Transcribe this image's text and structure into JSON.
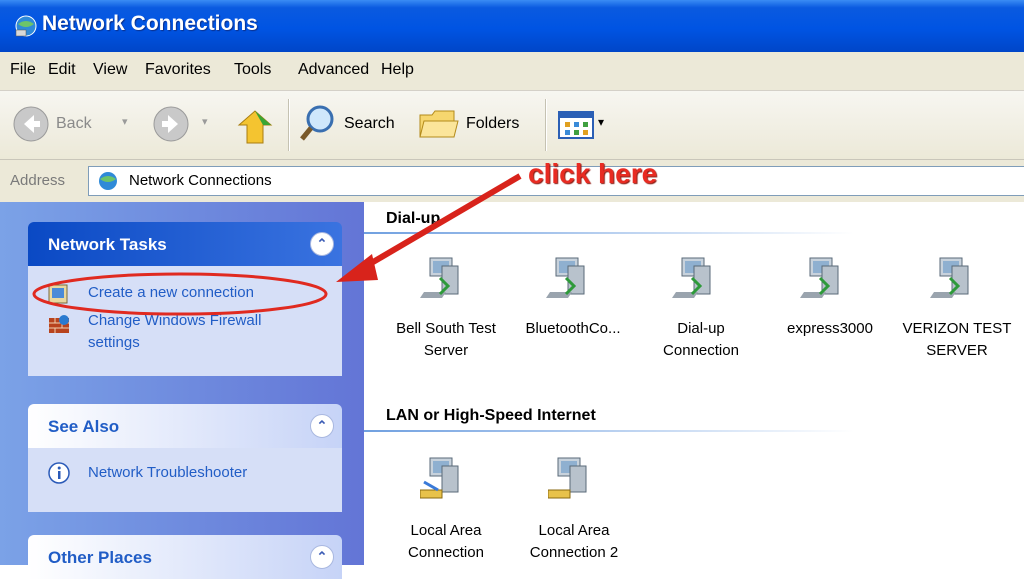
{
  "window": {
    "title": "Network Connections"
  },
  "menu": [
    "File",
    "Edit",
    "View",
    "Favorites",
    "Tools",
    "Advanced",
    "Help"
  ],
  "toolbar": {
    "back_label": "Back",
    "search_label": "Search",
    "folders_label": "Folders"
  },
  "address": {
    "label": "Address",
    "value": "Network Connections"
  },
  "annotation": {
    "text": "click here",
    "color": "#e82b22"
  },
  "sidebar": {
    "network_tasks": {
      "title": "Network Tasks",
      "items": [
        "Create a new connection",
        "Change Windows Firewall",
        "settings"
      ]
    },
    "see_also": {
      "title": "See Also",
      "items": [
        "Network Troubleshooter"
      ]
    },
    "other_places": {
      "title": "Other Places"
    }
  },
  "groups": {
    "dialup": {
      "title": "Dial-up",
      "items": [
        {
          "line1": "Bell South Test",
          "line2": "Server"
        },
        {
          "line1": "BluetoothCo...",
          "line2": ""
        },
        {
          "line1": "Dial-up",
          "line2": "Connection"
        },
        {
          "line1": "express3000",
          "line2": ""
        },
        {
          "line1": "VERIZON TEST",
          "line2": "SERVER"
        }
      ]
    },
    "lan": {
      "title": "LAN or High-Speed Internet",
      "items": [
        {
          "line1": "Local Area",
          "line2": "Connection"
        },
        {
          "line1": "Local Area",
          "line2": "Connection 2"
        }
      ]
    }
  }
}
